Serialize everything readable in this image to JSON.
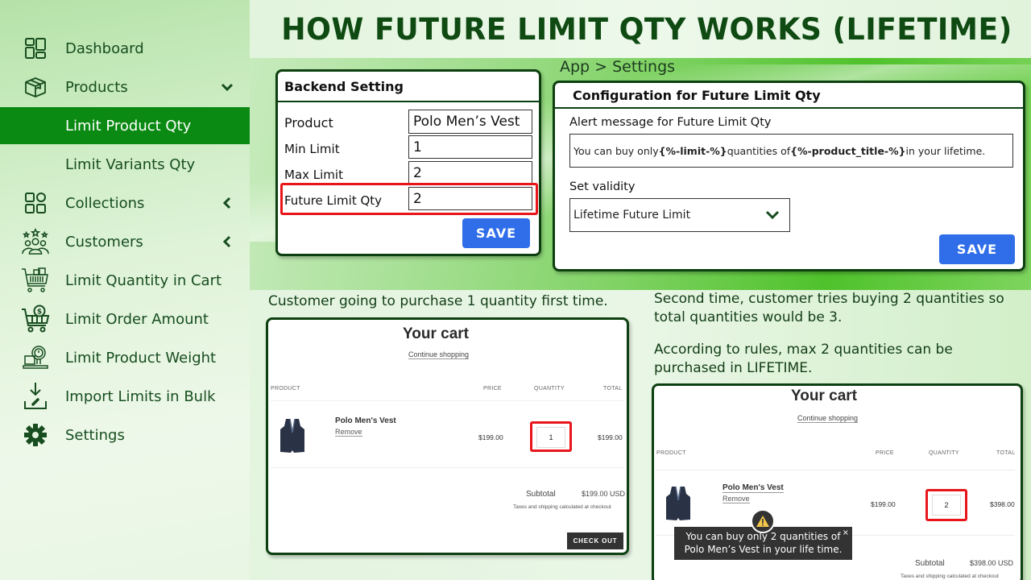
{
  "title": "HOW FUTURE LIMIT QTY WORKS (LIFETIME)",
  "breadcrumb": "App > Settings",
  "colors": {
    "brand_dark": "#0e4a12",
    "active_nav": "#0a8a12",
    "save_button": "#2f6ee8",
    "highlight_red": "#e8151a",
    "toast_bg": "#333333"
  },
  "sidebar": {
    "items": [
      {
        "label": "Dashboard",
        "icon": "dashboard-icon"
      },
      {
        "label": "Products",
        "icon": "box-icon",
        "chevron": "chevron-down-icon"
      },
      {
        "label": "Limit Product Qty",
        "active": true
      },
      {
        "label": "Limit Variants Qty"
      },
      {
        "label": "Collections",
        "icon": "collections-grid-icon",
        "chevron": "chevron-left-icon"
      },
      {
        "label": "Customers",
        "icon": "customers-stars-icon",
        "chevron": "chevron-left-icon"
      },
      {
        "label": "Limit Quantity in Cart",
        "icon": "cart-icon"
      },
      {
        "label": "Limit Order Amount",
        "icon": "cart-dollar-icon"
      },
      {
        "label": "Limit Product Weight",
        "icon": "weight-scale-icon"
      },
      {
        "label": "Import Limits in Bulk",
        "icon": "import-icon"
      },
      {
        "label": "Settings",
        "icon": "gear-icon"
      }
    ]
  },
  "backend": {
    "title": "Backend Setting",
    "fields": [
      {
        "label": "Product",
        "value": "Polo Men’s Vest"
      },
      {
        "label": "Min Limit",
        "value": "1"
      },
      {
        "label": "Max Limit",
        "value": "2"
      },
      {
        "label": "Future Limit Qty",
        "value": "2"
      }
    ],
    "save_label": "SAVE"
  },
  "config": {
    "title": "Configuration for Future Limit Qty",
    "alert_label": "Alert message for Future Limit Qty",
    "alert_parts": {
      "p1": "You can buy only ",
      "t1": "{%-limit-%}",
      "p2": " quantities of ",
      "t2": "{%-product_title-%}",
      "p3": " in your lifetime."
    },
    "validity_label": "Set validity",
    "validity_value": "Lifetime Future Limit",
    "save_label": "SAVE"
  },
  "captions": {
    "first": "Customer going to purchase 1 quantity first time.",
    "second_line1": "Second time, customer tries buying 2 quantities so",
    "second_line2": "total quantities would be 3.",
    "rule_line1": "According to rules, max 2 quantities can be",
    "rule_line2": "purchased in LIFETIME."
  },
  "cart1": {
    "title": "Your cart",
    "continue": "Continue shopping",
    "headers": {
      "product": "PRODUCT",
      "price": "PRICE",
      "quantity": "QUANTITY",
      "total": "TOTAL"
    },
    "item": {
      "name": "Polo Men's Vest",
      "remove": "Remove",
      "price": "$199.00",
      "qty": "1",
      "total": "$199.00"
    },
    "subtotal_label": "Subtotal",
    "subtotal_value": "$199.00 USD",
    "tax_note": "Taxes and shipping calculated at checkout",
    "checkout": "CHECK OUT"
  },
  "cart2": {
    "title": "Your cart",
    "continue": "Continue shopping",
    "headers": {
      "product": "PRODUCT",
      "price": "PRICE",
      "quantity": "QUANTITY",
      "total": "TOTAL"
    },
    "item": {
      "name": "Polo Men's Vest",
      "remove": "Remove",
      "price": "$199.00",
      "qty": "2",
      "total": "$398.00"
    },
    "subtotal_label": "Subtotal",
    "subtotal_value": "$398.00 USD",
    "tax_note": "Taxes and shipping calculated at checkout"
  },
  "toast": {
    "line1": "You can buy only 2 quantities of",
    "line2": "Polo Men’s Vest in your life time.",
    "close": "×"
  }
}
